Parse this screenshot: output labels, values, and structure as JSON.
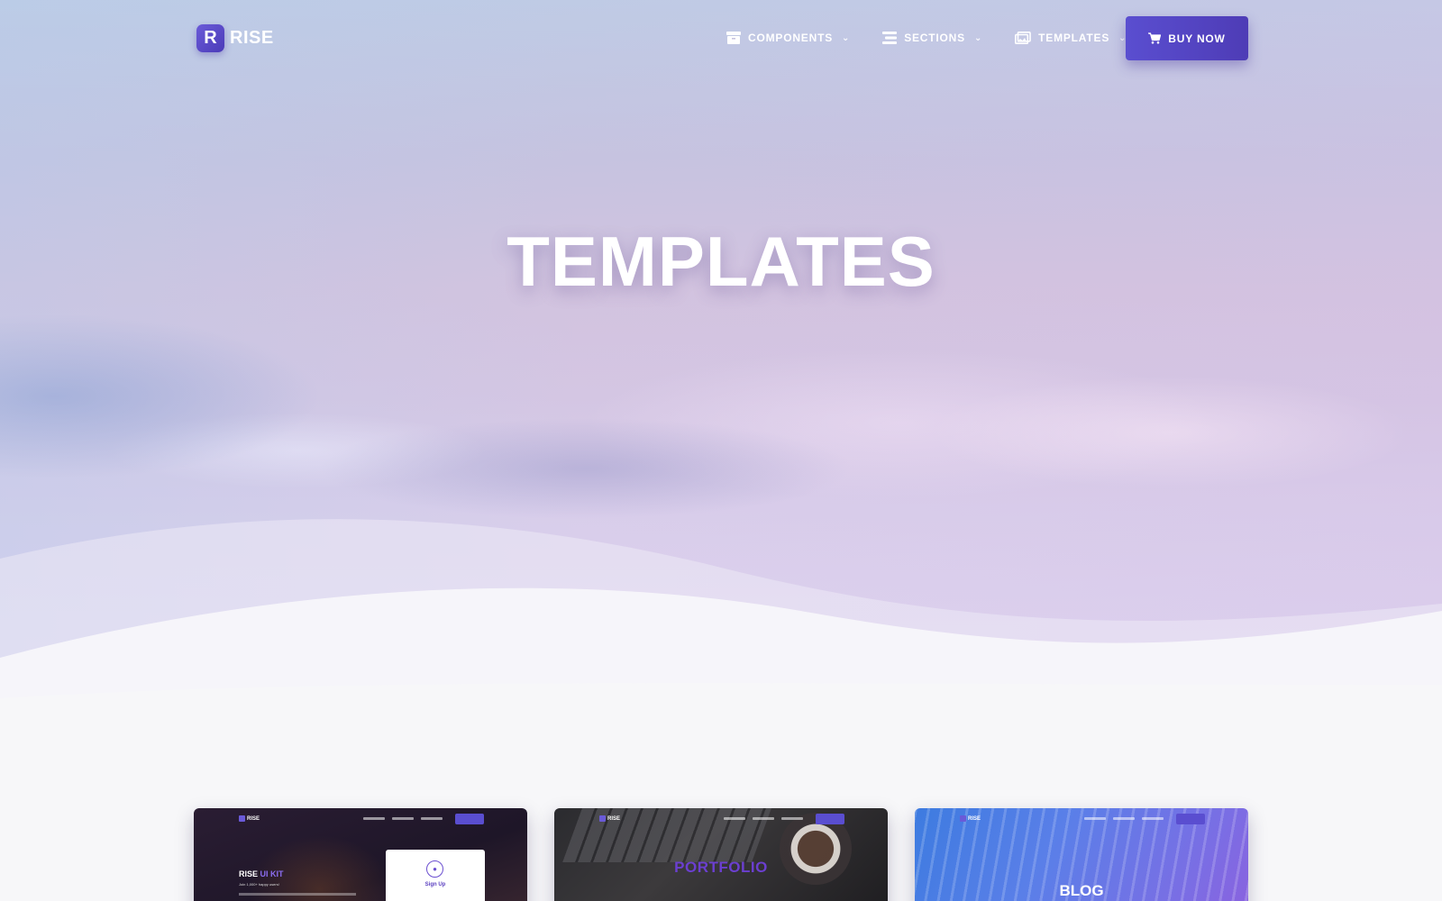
{
  "brand": {
    "mark": "R",
    "name": "RISE"
  },
  "nav": {
    "items": [
      {
        "label": "COMPONENTS",
        "icon": "archive-box-icon"
      },
      {
        "label": "SECTIONS",
        "icon": "list-lines-icon"
      },
      {
        "label": "TEMPLATES",
        "icon": "images-icon"
      }
    ],
    "buy_label": "BUY NOW",
    "buy_icon": "shopping-cart-icon"
  },
  "hero": {
    "title": "TEMPLATES"
  },
  "colors": {
    "accent": "#5a4ed0",
    "hero_top": "#bfcbe5",
    "hero_bottom": "#dfd5f1",
    "page_bg": "#f7f7f9"
  },
  "cards": [
    {
      "id": "uikit",
      "mini_brand": "RISE",
      "heading_main": "RISE",
      "heading_accent": "UI KIT",
      "subtitle": "Join 1,000+ happy users!",
      "panel_label": "Sign Up"
    },
    {
      "id": "portfolio",
      "mini_brand": "RISE",
      "heading": "PORTFOLIO"
    },
    {
      "id": "blog",
      "mini_brand": "RISE",
      "heading": "BLOG"
    }
  ]
}
